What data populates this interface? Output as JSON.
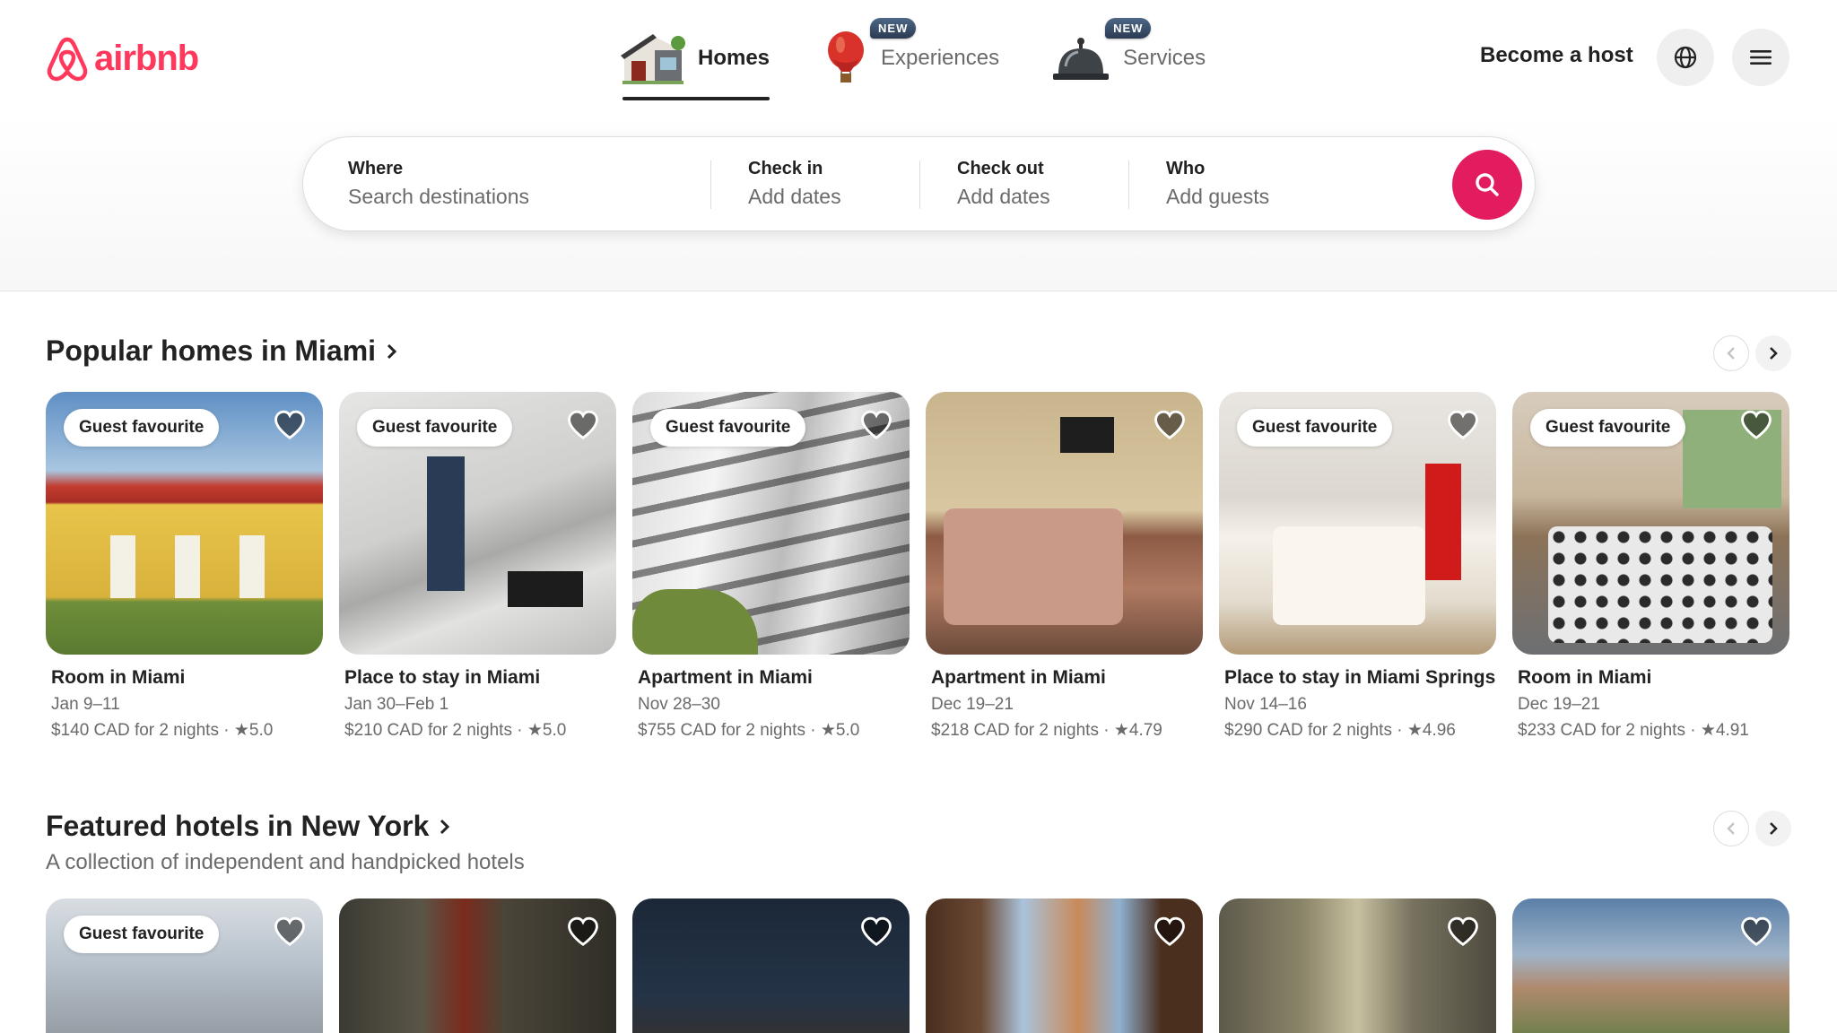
{
  "brand": {
    "logo_text": "airbnb",
    "accent": "#ff385c",
    "search_color": "#e31c5f"
  },
  "nav": {
    "items": [
      {
        "label": "Homes",
        "icon": "house-icon",
        "active": true,
        "badge": ""
      },
      {
        "label": "Experiences",
        "icon": "hot-air-balloon-icon",
        "active": false,
        "badge": "NEW"
      },
      {
        "label": "Services",
        "icon": "service-bell-icon",
        "active": false,
        "badge": "NEW"
      }
    ],
    "become_host": "Become a host",
    "globe_icon": "globe-icon",
    "menu_icon": "hamburger-menu-icon"
  },
  "search": {
    "where_label": "Where",
    "where_placeholder": "Search destinations",
    "checkin_label": "Check in",
    "checkin_value": "Add dates",
    "checkout_label": "Check out",
    "checkout_value": "Add dates",
    "who_label": "Who",
    "who_value": "Add guests",
    "button_icon": "search-icon"
  },
  "popular": {
    "title": "Popular homes in Miami",
    "listings": [
      {
        "badge": "Guest favourite",
        "title": "Room in Miami",
        "dates": "Jan 9–11",
        "price": "$140 CAD for 2 nights",
        "rating": "5.0"
      },
      {
        "badge": "Guest favourite",
        "title": "Place to stay in Miami",
        "dates": "Jan 30–Feb 1",
        "price": "$210 CAD for 2 nights",
        "rating": "5.0"
      },
      {
        "badge": "Guest favourite",
        "title": "Apartment in Miami",
        "dates": "Nov 28–30",
        "price": "$755 CAD for 2 nights",
        "rating": "5.0"
      },
      {
        "badge": "",
        "title": "Apartment in Miami",
        "dates": "Dec 19–21",
        "price": "$218 CAD for 2 nights",
        "rating": "4.79"
      },
      {
        "badge": "Guest favourite",
        "title": "Place to stay in Miami Springs",
        "dates": "Nov 14–16",
        "price": "$290 CAD for 2 nights",
        "rating": "4.96"
      },
      {
        "badge": "Guest favourite",
        "title": "Room in Miami",
        "dates": "Dec 19–21",
        "price": "$233 CAD for 2 nights",
        "rating": "4.91"
      }
    ]
  },
  "hotels": {
    "title": "Featured hotels in New York",
    "subtitle": "A collection of independent and handpicked hotels",
    "badges": [
      "Guest favourite",
      "",
      "",
      "",
      "",
      ""
    ]
  }
}
